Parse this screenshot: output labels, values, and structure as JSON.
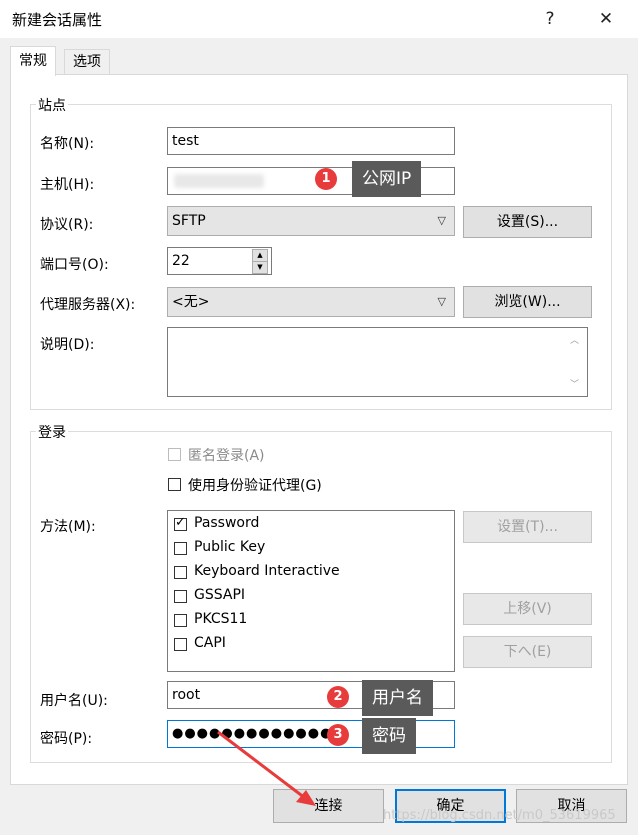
{
  "window": {
    "title": "新建会话属性",
    "help_glyph": "?",
    "close_glyph": "✕"
  },
  "tabs": [
    {
      "label": "常规",
      "active": true
    },
    {
      "label": "选项",
      "active": false
    }
  ],
  "site": {
    "group_title": "站点",
    "name_label": "名称(N):",
    "name_value": "test",
    "host_label": "主机(H):",
    "protocol_label": "协议(R):",
    "protocol_value": "SFTP",
    "protocol_settings_button": "设置(S)...",
    "port_label": "端口号(O):",
    "port_value": "22",
    "proxy_label": "代理服务器(X):",
    "proxy_value": "<无>",
    "proxy_browse_button": "浏览(W)...",
    "desc_label": "说明(D):",
    "desc_value": ""
  },
  "login": {
    "group_title": "登录",
    "anonymous_label": "匿名登录(A)",
    "anonymous_checked": false,
    "anonymous_disabled": true,
    "agent_label": "使用身份验证代理(G)",
    "agent_checked": false,
    "method_label": "方法(M):",
    "methods": [
      {
        "label": "Password",
        "checked": true
      },
      {
        "label": "Public Key",
        "checked": false
      },
      {
        "label": "Keyboard Interactive",
        "checked": false
      },
      {
        "label": "GSSAPI",
        "checked": false
      },
      {
        "label": "PKCS11",
        "checked": false
      },
      {
        "label": "CAPI",
        "checked": false
      }
    ],
    "method_settings_button": "设置(T)...",
    "move_up_button": "上移(V)",
    "move_down_button": "下へ(E)",
    "username_label": "用户名(U):",
    "username_value": "root",
    "password_label": "密码(P):",
    "password_value": "●●●●●●●●●●●●●●"
  },
  "footer": {
    "connect_button": "连接",
    "ok_button": "确定",
    "cancel_button": "取消"
  },
  "annotations": [
    {
      "number": "1",
      "text": "公网IP"
    },
    {
      "number": "2",
      "text": "用户名"
    },
    {
      "number": "3",
      "text": "密码"
    }
  ],
  "watermark": "https://blog.csdn.net/m0_53619965",
  "colors": {
    "badge": "#e83b3b",
    "callout": "#5a5a5a",
    "arrow": "#e83b3b",
    "focus_border": "#0078d7"
  }
}
